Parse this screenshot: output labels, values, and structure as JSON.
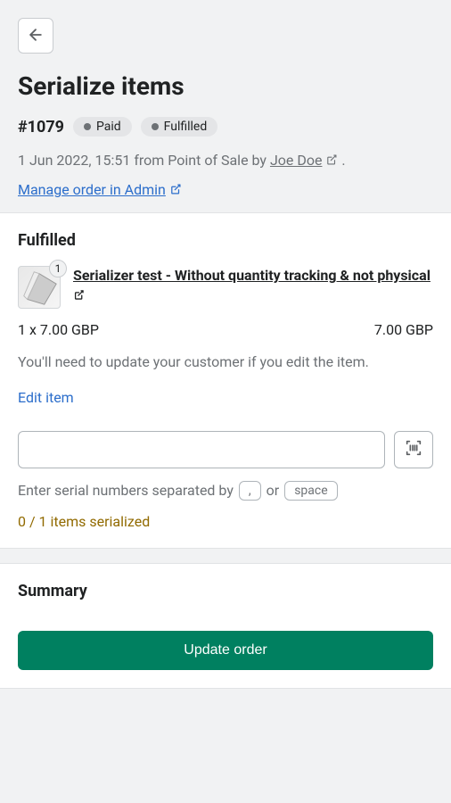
{
  "header": {
    "title": "Serialize items",
    "order_id": "#1079",
    "badges": [
      "Paid",
      "Fulfilled"
    ],
    "meta_prefix": "1 Jun 2022, 15:51 from Point of Sale by ",
    "meta_author": "Joe Doe",
    "meta_suffix": " .",
    "admin_link": "Manage order in Admin"
  },
  "fulfilled": {
    "section_title": "Fulfilled",
    "item_qty_badge": "1",
    "item_title": "Serializer test - Without quantity tracking & not physical",
    "qty_price": "1 x 7.00 GBP",
    "line_total": "7.00 GBP",
    "notice": "You'll need to update your customer if you edit the item.",
    "edit_link": "Edit item",
    "serial_placeholder": "",
    "helper_text": "Enter serial numbers separated by",
    "helper_key1": ",",
    "helper_or": "or",
    "helper_key2": "space",
    "progress": "0 / 1 items serialized"
  },
  "summary": {
    "title": "Summary",
    "button": "Update order"
  },
  "icons": {
    "back": "back-icon",
    "external": "external-link-icon",
    "barcode": "barcode-icon"
  }
}
